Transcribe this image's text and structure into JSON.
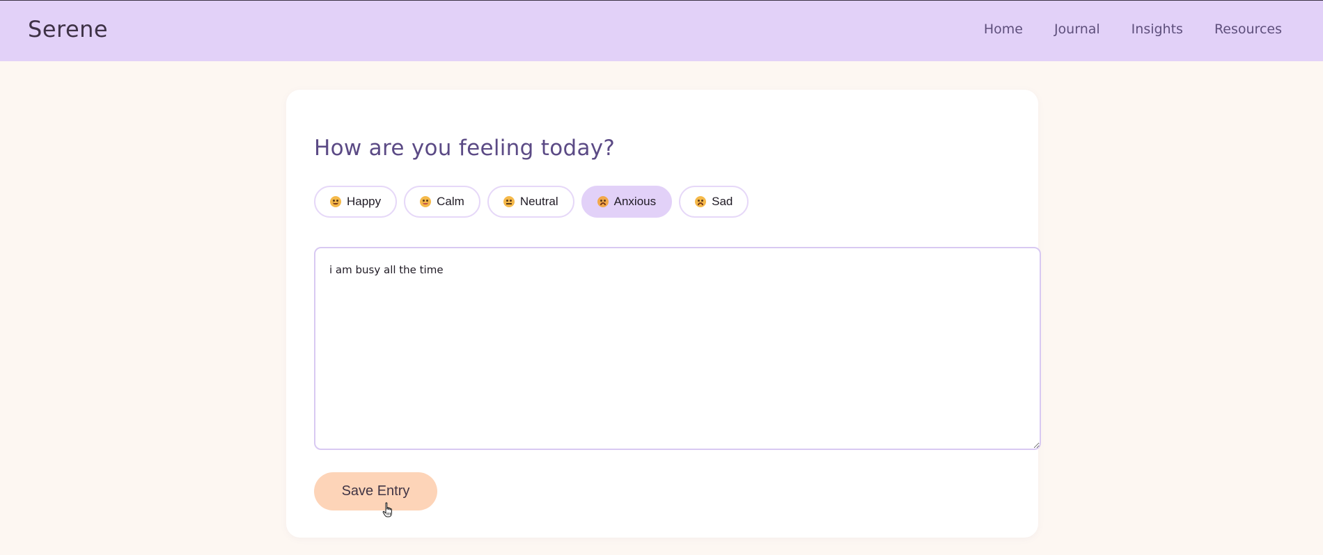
{
  "app": {
    "title": "Serene"
  },
  "nav": {
    "items": [
      {
        "label": "Home"
      },
      {
        "label": "Journal"
      },
      {
        "label": "Insights"
      },
      {
        "label": "Resources"
      }
    ]
  },
  "journal": {
    "title": "How are you feeling today?",
    "moods": [
      {
        "label": "Happy",
        "icon": "happy-face-icon",
        "selected": false
      },
      {
        "label": "Calm",
        "icon": "calm-face-icon",
        "selected": false
      },
      {
        "label": "Neutral",
        "icon": "neutral-face-icon",
        "selected": false
      },
      {
        "label": "Anxious",
        "icon": "anxious-face-icon",
        "selected": true
      },
      {
        "label": "Sad",
        "icon": "sad-face-icon",
        "selected": false
      }
    ],
    "entry_value": "i am busy all the time",
    "save_label": "Save Entry"
  },
  "colors": {
    "header_bg": "#e2d1f8",
    "page_bg": "#fdf7f2",
    "accent_text": "#5b4a85",
    "selected_mood_bg": "#e2d1f8",
    "save_button_bg": "#fdd4b8"
  }
}
